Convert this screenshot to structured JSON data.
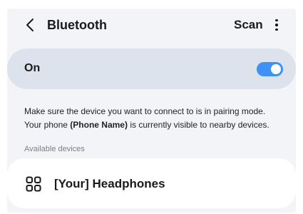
{
  "header": {
    "title": "Bluetooth",
    "scan_label": "Scan",
    "back_icon": "chevron-left-icon",
    "more_icon": "more-vertical-icon"
  },
  "bluetooth_toggle": {
    "label": "On",
    "enabled": true,
    "accent_color": "#3e91f7"
  },
  "info": {
    "line1": "Make sure the device you want to connect to is in pairing mode.",
    "line2_prefix": "Your phone ",
    "phone_name": "(Phone Name)",
    "line2_suffix": " is currently visible to nearby devices."
  },
  "available_devices": {
    "section_label": "Available devices",
    "devices": [
      {
        "name": "[Your] Headphones",
        "icon": "device-grid-icon"
      }
    ]
  }
}
